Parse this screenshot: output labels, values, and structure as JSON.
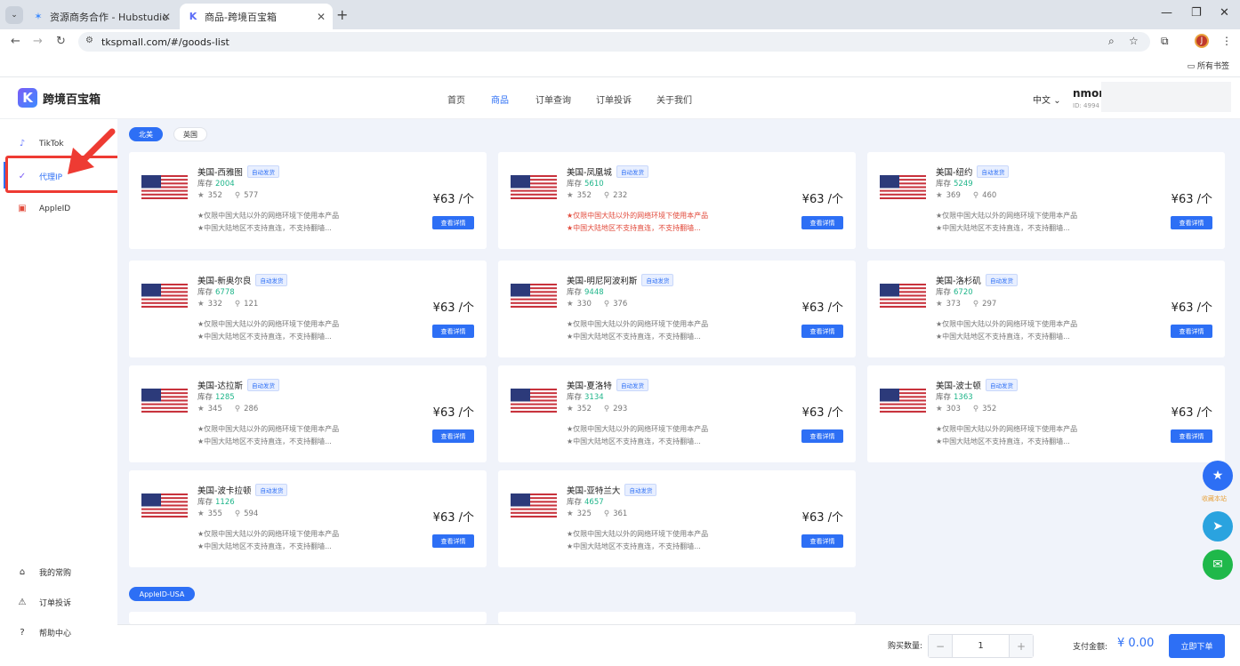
{
  "browser": {
    "tabs": [
      {
        "title": "资源商务合作 - Hubstudio"
      },
      {
        "title": "商品-跨境百宝箱"
      }
    ],
    "url": "tkspmall.com/#/goods-list",
    "bookmarks_all": "所有书签",
    "profile_initial": "J"
  },
  "header": {
    "logo_text": "跨境百宝箱",
    "logo_letter": "K",
    "nav": [
      "首页",
      "商品",
      "订单查询",
      "订单投诉",
      "关于我们"
    ],
    "active_nav": "商品",
    "language": "中文",
    "username": "nmom",
    "user_id": "ID: 4994"
  },
  "sidebar": {
    "items": [
      {
        "label": "TikTok",
        "icon": "tiktok-icon"
      },
      {
        "label": "代理IP",
        "icon": "check-icon"
      },
      {
        "label": "AppleID",
        "icon": "apple-id-icon"
      }
    ],
    "bottom_items": [
      {
        "label": "我的常购",
        "icon": "bag-icon"
      },
      {
        "label": "订单投诉",
        "icon": "warning-icon"
      },
      {
        "label": "帮助中心",
        "icon": "help-icon"
      }
    ]
  },
  "region_tabs": [
    "北美",
    "英国"
  ],
  "products": [
    {
      "title": "美国-西雅图",
      "badge": "自动发货",
      "stock_label": "库存",
      "stock": "2004",
      "rating": "352",
      "sales": "577",
      "price": "¥63 /个",
      "button": "查看详情",
      "note1": "★仅限中国大陆以外的网络环境下使用本产品",
      "note2": "★中国大陆地区不支持直连，不支持翻墙...",
      "highlight": false
    },
    {
      "title": "美国-凤凰城",
      "badge": "自动发货",
      "stock_label": "库存",
      "stock": "5610",
      "rating": "352",
      "sales": "232",
      "price": "¥63 /个",
      "button": "查看详情",
      "note1": "★仅限中国大陆以外的网络环境下使用本产品",
      "note2": "★中国大陆地区不支持直连，不支持翻墙...",
      "highlight": true
    },
    {
      "title": "美国-纽约",
      "badge": "自动发货",
      "stock_label": "库存",
      "stock": "5249",
      "rating": "369",
      "sales": "460",
      "price": "¥63 /个",
      "button": "查看详情",
      "note1": "★仅限中国大陆以外的网络环境下使用本产品",
      "note2": "★中国大陆地区不支持直连，不支持翻墙...",
      "highlight": false
    },
    {
      "title": "美国-新奥尔良",
      "badge": "自动发货",
      "stock_label": "库存",
      "stock": "6778",
      "rating": "332",
      "sales": "121",
      "price": "¥63 /个",
      "button": "查看详情",
      "note1": "★仅限中国大陆以外的网络环境下使用本产品",
      "note2": "★中国大陆地区不支持直连，不支持翻墙...",
      "highlight": false
    },
    {
      "title": "美国-明尼阿波利斯",
      "badge": "自动发货",
      "stock_label": "库存",
      "stock": "9448",
      "rating": "330",
      "sales": "376",
      "price": "¥63 /个",
      "button": "查看详情",
      "note1": "★仅限中国大陆以外的网络环境下使用本产品",
      "note2": "★中国大陆地区不支持直连，不支持翻墙...",
      "highlight": false
    },
    {
      "title": "美国-洛杉矶",
      "badge": "自动发货",
      "stock_label": "库存",
      "stock": "6720",
      "rating": "373",
      "sales": "297",
      "price": "¥63 /个",
      "button": "查看详情",
      "note1": "★仅限中国大陆以外的网络环境下使用本产品",
      "note2": "★中国大陆地区不支持直连，不支持翻墙...",
      "highlight": false
    },
    {
      "title": "美国-达拉斯",
      "badge": "自动发货",
      "stock_label": "库存",
      "stock": "1285",
      "rating": "345",
      "sales": "286",
      "price": "¥63 /个",
      "button": "查看详情",
      "note1": "★仅限中国大陆以外的网络环境下使用本产品",
      "note2": "★中国大陆地区不支持直连，不支持翻墙...",
      "highlight": false
    },
    {
      "title": "美国-夏洛特",
      "badge": "自动发货",
      "stock_label": "库存",
      "stock": "3134",
      "rating": "352",
      "sales": "293",
      "price": "¥63 /个",
      "button": "查看详情",
      "note1": "★仅限中国大陆以外的网络环境下使用本产品",
      "note2": "★中国大陆地区不支持直连，不支持翻墙...",
      "highlight": false
    },
    {
      "title": "美国-波士顿",
      "badge": "自动发货",
      "stock_label": "库存",
      "stock": "1363",
      "rating": "303",
      "sales": "352",
      "price": "¥63 /个",
      "button": "查看详情",
      "note1": "★仅限中国大陆以外的网络环境下使用本产品",
      "note2": "★中国大陆地区不支持直连，不支持翻墙...",
      "highlight": false
    },
    {
      "title": "美国-波卡拉顿",
      "badge": "自动发货",
      "stock_label": "库存",
      "stock": "1126",
      "rating": "355",
      "sales": "594",
      "price": "¥63 /个",
      "button": "查看详情",
      "note1": "★仅限中国大陆以外的网络环境下使用本产品",
      "note2": "★中国大陆地区不支持直连，不支持翻墙...",
      "highlight": false
    },
    {
      "title": "美国-亚特兰大",
      "badge": "自动发货",
      "stock_label": "库存",
      "stock": "4657",
      "rating": "325",
      "sales": "361",
      "price": "¥63 /个",
      "button": "查看详情",
      "note1": "★仅限中国大陆以外的网络环境下使用本产品",
      "note2": "★中国大陆地区不支持直连，不支持翻墙...",
      "highlight": false
    }
  ],
  "section2": {
    "title": "AppleID-USA"
  },
  "floating": {
    "favorite_label": "收藏本站"
  },
  "bottom": {
    "qty_label": "购买数量:",
    "qty_value": "1",
    "minus": "−",
    "plus": "+",
    "pay_label": "支付金额:",
    "pay_amount": "¥ 0.00",
    "order_button": "立即下单"
  },
  "colors": {
    "accent": "#2d6ff5",
    "stock_green": "#1fb58a",
    "warn_red": "#e24a3b",
    "annotation": "#ee3b33"
  }
}
